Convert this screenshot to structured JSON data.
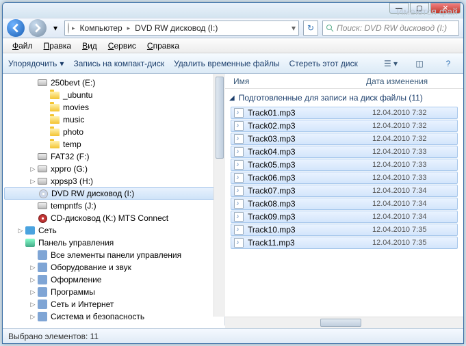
{
  "titlebar": {
    "min": "—",
    "max": "▢",
    "close": "✕"
  },
  "nav": {
    "crumbs": [
      "Компьютер",
      "DVD RW дисковод (I:)"
    ],
    "sep": "▸",
    "search_placeholder": "Поиск: DVD RW дисковод (I:)"
  },
  "menu": {
    "file": "Файл",
    "edit": "Правка",
    "view": "Вид",
    "service": "Сервис",
    "help": "Справка"
  },
  "toolbar": {
    "organize": "Упорядочить",
    "burn": "Запись на компакт-диск",
    "delete_temp": "Удалить временные файлы",
    "erase": "Стереть этот диск"
  },
  "columns": {
    "name": "Имя",
    "modified": "Дата изменения"
  },
  "group": {
    "title": "Подготовленные для записи на диск файлы",
    "count": "(11)"
  },
  "tree": [
    {
      "indent": 2,
      "exp": "",
      "icon": "drive",
      "label": "250bevt (E:)"
    },
    {
      "indent": 3,
      "exp": "",
      "icon": "folder",
      "label": "_ubuntu"
    },
    {
      "indent": 3,
      "exp": "",
      "icon": "folder",
      "label": "movies"
    },
    {
      "indent": 3,
      "exp": "",
      "icon": "folder",
      "label": "music"
    },
    {
      "indent": 3,
      "exp": "",
      "icon": "folder",
      "label": "photo"
    },
    {
      "indent": 3,
      "exp": "",
      "icon": "folder",
      "label": "temp"
    },
    {
      "indent": 2,
      "exp": "",
      "icon": "drive",
      "label": "FAT32 (F:)"
    },
    {
      "indent": 2,
      "exp": "▷",
      "icon": "drive",
      "label": "xppro (G:)"
    },
    {
      "indent": 2,
      "exp": "▷",
      "icon": "drive",
      "label": "xppsp3 (H:)"
    },
    {
      "indent": 2,
      "exp": "",
      "icon": "disc",
      "label": "DVD RW дисковод (I:)",
      "sel": true
    },
    {
      "indent": 2,
      "exp": "",
      "icon": "drive",
      "label": "tempntfs (J:)"
    },
    {
      "indent": 2,
      "exp": "",
      "icon": "reddisc",
      "label": "CD-дисковод (K:) MTS Connect"
    },
    {
      "indent": 1,
      "exp": "▷",
      "icon": "net",
      "label": "Сеть"
    },
    {
      "indent": 1,
      "exp": "",
      "icon": "cp",
      "label": "Панель управления"
    },
    {
      "indent": 2,
      "exp": "",
      "icon": "cpitem",
      "label": "Все элементы панели управления"
    },
    {
      "indent": 2,
      "exp": "▷",
      "icon": "cpitem",
      "label": "Оборудование и звук"
    },
    {
      "indent": 2,
      "exp": "▷",
      "icon": "cpitem",
      "label": "Оформление"
    },
    {
      "indent": 2,
      "exp": "▷",
      "icon": "cpitem",
      "label": "Программы"
    },
    {
      "indent": 2,
      "exp": "▷",
      "icon": "cpitem",
      "label": "Сеть и Интернет"
    },
    {
      "indent": 2,
      "exp": "▷",
      "icon": "cpitem",
      "label": "Система и безопасность"
    }
  ],
  "files": [
    {
      "name": "Track01.mp3",
      "date": "12.04.2010 7:32"
    },
    {
      "name": "Track02.mp3",
      "date": "12.04.2010 7:32"
    },
    {
      "name": "Track03.mp3",
      "date": "12.04.2010 7:32"
    },
    {
      "name": "Track04.mp3",
      "date": "12.04.2010 7:33"
    },
    {
      "name": "Track05.mp3",
      "date": "12.04.2010 7:33"
    },
    {
      "name": "Track06.mp3",
      "date": "12.04.2010 7:33"
    },
    {
      "name": "Track07.mp3",
      "date": "12.04.2010 7:34"
    },
    {
      "name": "Track08.mp3",
      "date": "12.04.2010 7:34"
    },
    {
      "name": "Track09.mp3",
      "date": "12.04.2010 7:34"
    },
    {
      "name": "Track10.mp3",
      "date": "12.04.2010 7:35"
    },
    {
      "name": "Track11.mp3",
      "date": "12.04.2010 7:35"
    }
  ],
  "status": {
    "text": "Выбрано элементов: 11"
  },
  "watermark": "Имеются фай"
}
